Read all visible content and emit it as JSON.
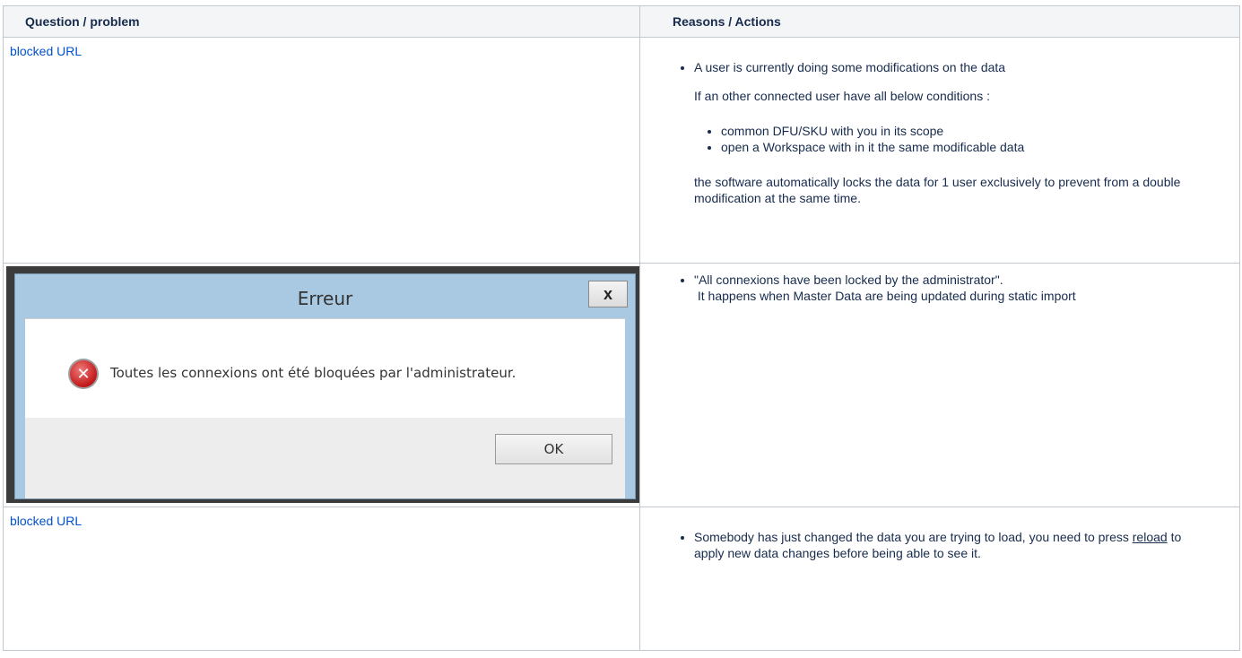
{
  "table": {
    "headers": [
      "Question / problem",
      "Reasons / Actions"
    ],
    "row1": {
      "link": "blocked URL",
      "bullet": "A user is currently doing some modifications on the data",
      "para": "If an other connected user have all below conditions :",
      "conditions": [
        "common DFU/SKU with you in its scope",
        "open a Workspace with in it the same modificable data"
      ],
      "closing": " the software automatically locks the data for 1 user exclusively to prevent from a double modification at the same time."
    },
    "row2": {
      "dialog": {
        "title": "Erreur",
        "close": "x",
        "message": "Toutes les connexions ont été bloquées par l'administrateur.",
        "ok": "OK",
        "icon": "error-icon"
      },
      "bullet_line1": "\"All connexions have been locked by the administrator\".",
      "bullet_line2": " It happens when Master Data are being updated during static import"
    },
    "row3": {
      "link": "blocked URL",
      "text_before": "Somebody has just changed the data you are trying to load, you need to press ",
      "reload": "reload",
      "text_after": " to apply new data changes before being able to see it."
    }
  },
  "colors": {
    "link": "#0052cc",
    "border": "#c1c7d0",
    "header_bg": "#f4f5f7"
  }
}
